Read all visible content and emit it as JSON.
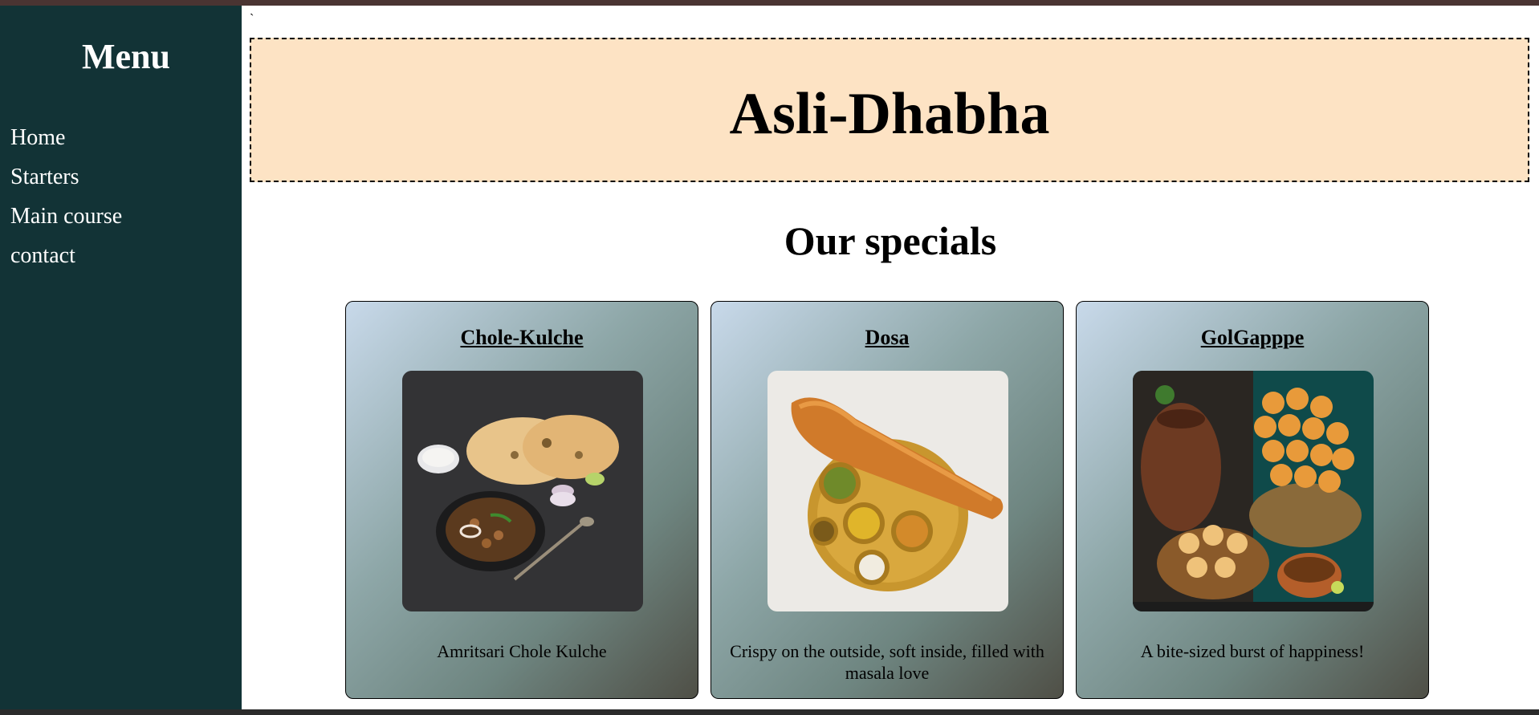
{
  "sidebar": {
    "title": "Menu",
    "items": [
      {
        "label": "Home"
      },
      {
        "label": "Starters"
      },
      {
        "label": "Main course"
      },
      {
        "label": "contact"
      }
    ]
  },
  "main": {
    "stray_text": "`",
    "banner_title": "Asli-Dhabha",
    "section_title": "Our specials",
    "cards": [
      {
        "title": "Chole-Kulche",
        "image": "chole-kulche-photo",
        "description": "Amritsari Chole Kulche"
      },
      {
        "title": "Dosa",
        "image": "dosa-photo",
        "description": "Crispy on the outside, soft inside, filled with masala love"
      },
      {
        "title": "GolGapppe",
        "image": "golgappe-photo",
        "description": "A bite-sized burst of happiness!"
      }
    ]
  },
  "colors": {
    "sidebar_bg": "#123336",
    "banner_bg": "#fde3c4",
    "top_strip": "#4a3432"
  }
}
